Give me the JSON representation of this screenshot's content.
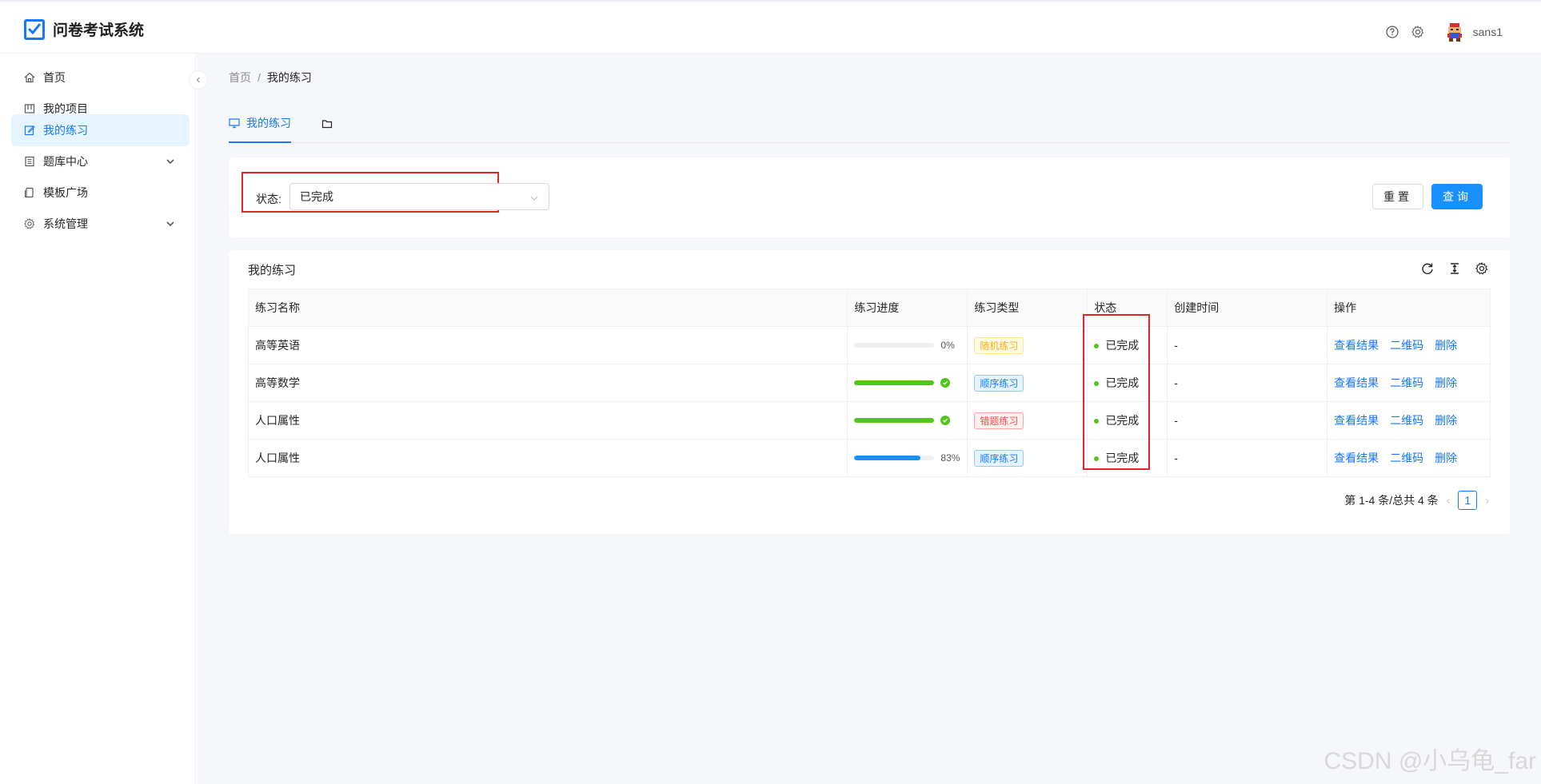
{
  "app": {
    "title": "问卷考试系统"
  },
  "header": {
    "username": "sans1"
  },
  "sidebar": {
    "items": [
      {
        "label": "首页",
        "icon": "home-icon"
      },
      {
        "label": "我的项目",
        "icon": "project-icon"
      },
      {
        "label": "我的练习",
        "icon": "edit-icon",
        "active": true
      },
      {
        "label": "题库中心",
        "icon": "book-icon",
        "expandable": true
      },
      {
        "label": "模板广场",
        "icon": "template-icon"
      },
      {
        "label": "系统管理",
        "icon": "gear-icon",
        "expandable": true
      }
    ]
  },
  "breadcrumb": {
    "home": "首页",
    "sep": "/",
    "current": "我的练习"
  },
  "tabs": [
    {
      "label": "我的练习",
      "icon": "desktop-icon"
    },
    {
      "label": "",
      "icon": "folder-icon"
    }
  ],
  "filter": {
    "label": "状态:",
    "value": "已完成",
    "reset_label": "重置",
    "query_label": "查询"
  },
  "table": {
    "title": "我的练习",
    "columns": [
      "练习名称",
      "练习进度",
      "练习类型",
      "状态",
      "创建时间",
      "操作"
    ],
    "rows": [
      {
        "name": "高等英语",
        "progress": 0,
        "progress_text": "0%",
        "type": "随机练习",
        "status": "已完成",
        "created": "-"
      },
      {
        "name": "高等数学",
        "progress": 100,
        "progress_text": "",
        "type": "顺序练习",
        "status": "已完成",
        "created": "-"
      },
      {
        "name": "人口属性",
        "progress": 100,
        "progress_text": "",
        "type": "错题练习",
        "status": "已完成",
        "created": "-"
      },
      {
        "name": "人口属性",
        "progress": 83,
        "progress_text": "83%",
        "type": "顺序练习",
        "status": "已完成",
        "created": "-"
      }
    ],
    "actions": {
      "view": "查看结果",
      "qrcode": "二维码",
      "delete": "删除"
    }
  },
  "pagination": {
    "summary": "第 1-4 条/总共 4 条",
    "current": "1"
  },
  "watermark": "CSDN @小乌龟_far",
  "colors": {
    "accent": "#1677ff",
    "success": "#52c41a",
    "highlight": "#e0262b"
  }
}
